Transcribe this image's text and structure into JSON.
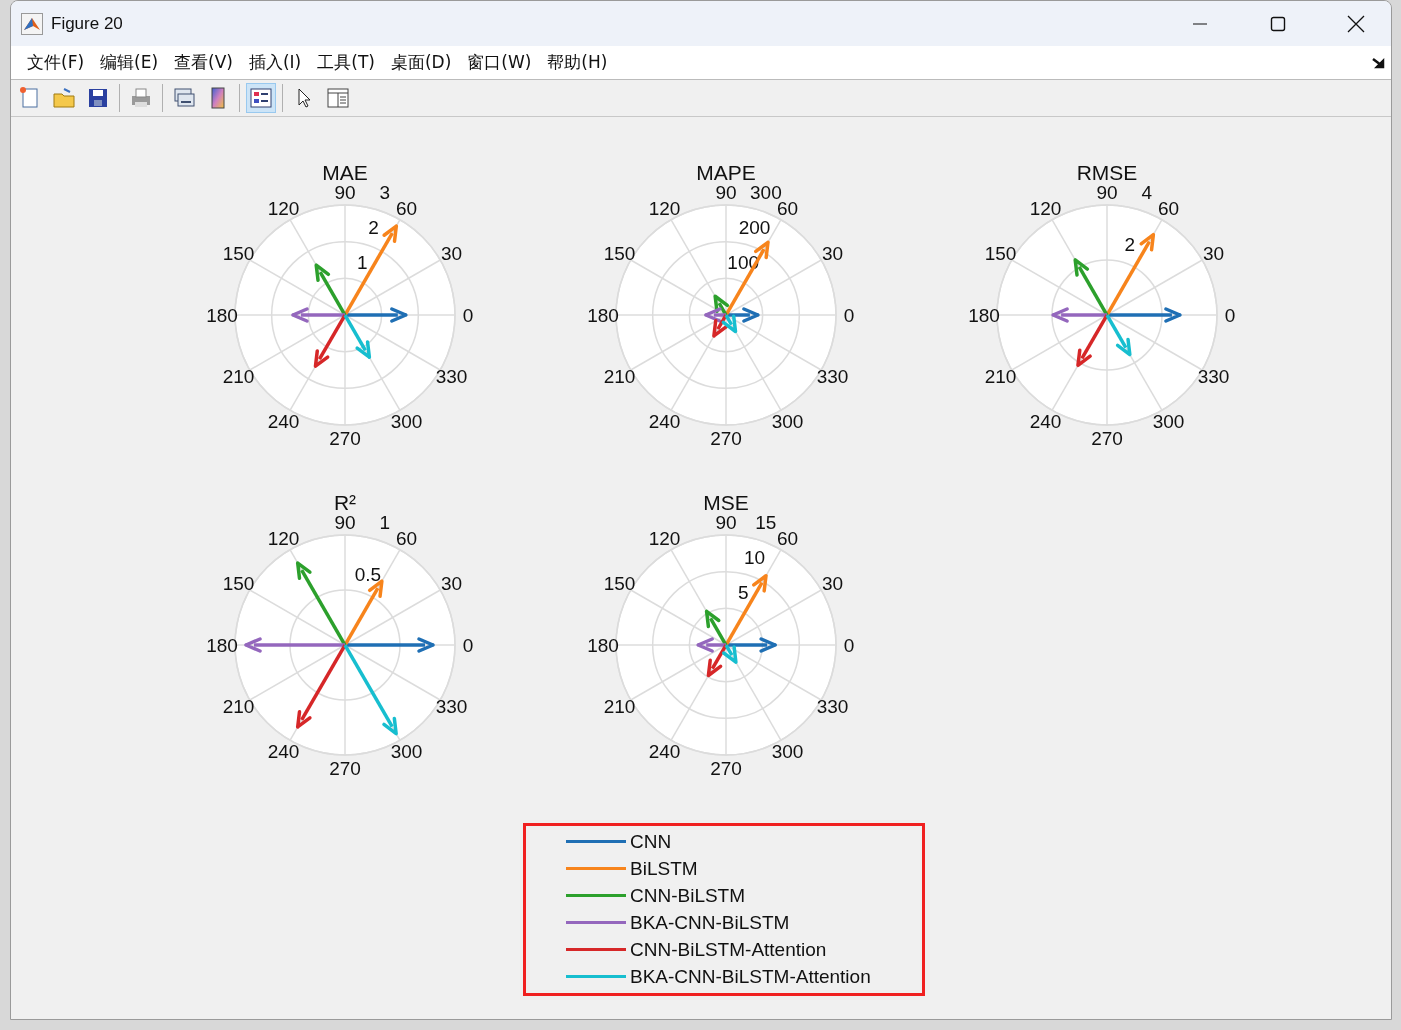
{
  "window": {
    "title": "Figure 20"
  },
  "menu": [
    "文件(F)",
    "编辑(E)",
    "查看(V)",
    "插入(I)",
    "工具(T)",
    "桌面(D)",
    "窗口(W)",
    "帮助(H)"
  ],
  "toolbar": [
    {
      "kind": "new",
      "selected": false
    },
    {
      "kind": "open",
      "selected": false
    },
    {
      "kind": "save",
      "selected": false
    },
    {
      "kind": "print",
      "selected": false
    },
    {
      "kind": "link",
      "selected": false
    },
    {
      "kind": "colorbar",
      "selected": false
    },
    {
      "kind": "legend",
      "selected": true
    },
    {
      "kind": "pointer",
      "selected": false
    },
    {
      "kind": "panel",
      "selected": false
    }
  ],
  "plots": [
    {
      "title": "MAE",
      "radius_labels": [
        "1",
        "2",
        "3"
      ],
      "angle_labels": [
        "0",
        "30",
        "60",
        "90",
        "120",
        "150",
        "180",
        "210",
        "240",
        "270",
        "300",
        "330"
      ],
      "arrows": [
        {
          "level": 0.553
        },
        {
          "level": 0.933
        },
        {
          "level": 0.523
        },
        {
          "level": 0.473
        },
        {
          "level": 0.537
        },
        {
          "level": 0.443
        }
      ]
    },
    {
      "title": "MAPE",
      "radius_labels": [
        "100",
        "200",
        "300"
      ],
      "angle_labels": [
        "0",
        "30",
        "60",
        "90",
        "120",
        "150",
        "180",
        "210",
        "240",
        "270",
        "300",
        "330"
      ],
      "arrows": [
        {
          "level": 0.29
        },
        {
          "level": 0.763
        },
        {
          "level": 0.197
        },
        {
          "level": 0.183
        },
        {
          "level": 0.22
        },
        {
          "level": 0.173
        }
      ]
    },
    {
      "title": "RMSE",
      "radius_labels": [
        "2",
        "4"
      ],
      "angle_labels": [
        "0",
        "30",
        "60",
        "90",
        "120",
        "150",
        "180",
        "210",
        "240",
        "270",
        "300",
        "330"
      ],
      "arrows": [
        {
          "level": 0.663
        },
        {
          "level": 0.843
        },
        {
          "level": 0.578
        },
        {
          "level": 0.49
        },
        {
          "level": 0.528
        },
        {
          "level": 0.415
        }
      ]
    },
    {
      "title": "R²",
      "radius_labels": [
        "0.5",
        "1"
      ],
      "angle_labels": [
        "0",
        "30",
        "60",
        "90",
        "120",
        "150",
        "180",
        "210",
        "240",
        "270",
        "300",
        "330"
      ],
      "arrows": [
        {
          "level": 0.8
        },
        {
          "level": 0.67
        },
        {
          "level": 0.86
        },
        {
          "level": 0.9
        },
        {
          "level": 0.86
        },
        {
          "level": 0.93
        }
      ]
    },
    {
      "title": "MSE",
      "radius_labels": [
        "5",
        "10",
        "15"
      ],
      "angle_labels": [
        "0",
        "30",
        "60",
        "90",
        "120",
        "150",
        "180",
        "210",
        "240",
        "270",
        "300",
        "330"
      ],
      "arrows": [
        {
          "level": 0.447
        },
        {
          "level": 0.727
        },
        {
          "level": 0.353
        },
        {
          "level": 0.253
        },
        {
          "level": 0.32
        },
        {
          "level": 0.18
        }
      ]
    }
  ],
  "legend": [
    {
      "label": "CNN",
      "color": "#1f6fb4"
    },
    {
      "label": "BiLSTM",
      "color": "#f7841c"
    },
    {
      "label": "CNN-BiLSTM",
      "color": "#2ca02c"
    },
    {
      "label": "BKA-CNN-BiLSTM",
      "color": "#9467bd"
    },
    {
      "label": "CNN-BiLSTM-Attention",
      "color": "#d62728"
    },
    {
      "label": "BKA-CNN-BiLSTM-Attention",
      "color": "#17becf"
    }
  ]
}
